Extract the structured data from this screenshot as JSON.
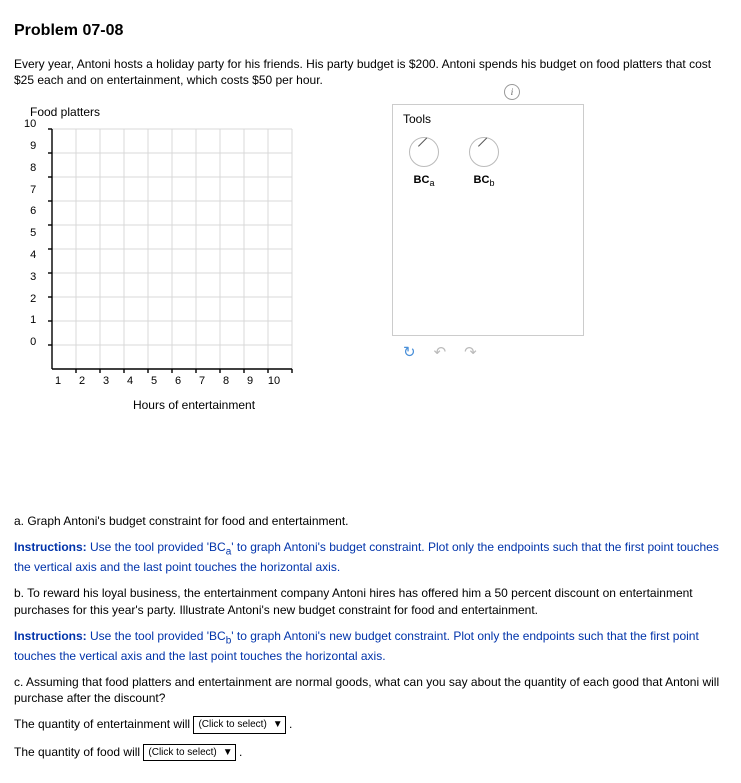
{
  "title": "Problem 07-08",
  "intro": "Every year, Antoni hosts a holiday party for his friends. His party budget is $200. Antoni spends his budget on food platters that cost $25 each and on entertainment, which costs $50 per hour.",
  "info_icon": "i",
  "chart": {
    "y_label": "Food platters",
    "x_label": "Hours of entertainment",
    "y_ticks": [
      "10",
      "9",
      "8",
      "7",
      "6",
      "5",
      "4",
      "3",
      "2",
      "1",
      "0"
    ],
    "x_ticks": [
      "1",
      "2",
      "3",
      "4",
      "5",
      "6",
      "7",
      "8",
      "9",
      "10"
    ]
  },
  "tools": {
    "title": "Tools",
    "bca": "BC",
    "bca_sub": "a",
    "bcb": "BC",
    "bcb_sub": "b"
  },
  "qa": "a. Graph Antoni's budget constraint for food and entertainment.",
  "instr1_lead": "Instructions:",
  "instr1_body": " Use the tool provided 'BC",
  "instr1_sub": "a",
  "instr1_tail": "' to graph Antoni's budget constraint. Plot only the endpoints such that the first point touches the vertical axis and the last point touches the horizontal axis.",
  "qb": "b. To reward his loyal business, the entertainment company Antoni hires has offered him a 50 percent discount on entertainment purchases for this year's party. Illustrate Antoni's new budget constraint for food and entertainment.",
  "instr2_lead": "Instructions:",
  "instr2_body": " Use the tool provided 'BC",
  "instr2_sub": "b",
  "instr2_tail": "' to graph Antoni's new budget constraint. Plot only the endpoints such that the first point touches the vertical axis and the last point touches the horizontal axis.",
  "qc": "c. Assuming that food platters and entertainment are normal goods, what can you say about the quantity of each good that Antoni will purchase after the discount?",
  "line1_lead": "The quantity of entertainment will ",
  "line2_lead": "The quantity of food will ",
  "select_text": "(Click to select)",
  "chart_data": {
    "type": "scatter",
    "title": "",
    "xlabel": "Hours of entertainment",
    "ylabel": "Food platters",
    "xlim": [
      0,
      10
    ],
    "ylim": [
      0,
      10
    ],
    "series": []
  }
}
